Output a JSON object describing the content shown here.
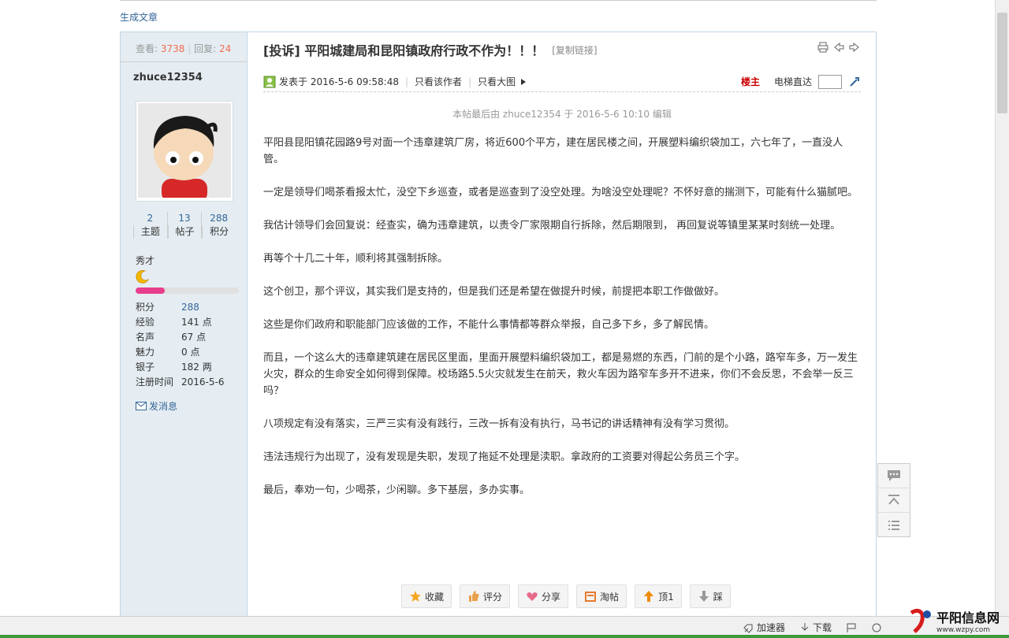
{
  "top_link": "生成文章",
  "stats": {
    "views_label": "查看:",
    "views": "3738",
    "replies_label": "回复:",
    "replies": "24"
  },
  "user": {
    "name": "zhuce12354",
    "counts": [
      {
        "value": "2",
        "label": "主题"
      },
      {
        "value": "13",
        "label": "帖子"
      },
      {
        "value": "288",
        "label": "积分"
      }
    ],
    "rank": "秀才",
    "rank_progress": 0.28,
    "info": [
      {
        "k": "积分",
        "v": "288"
      },
      {
        "k": "经验",
        "v": "141 点"
      },
      {
        "k": "名声",
        "v": "67 点"
      },
      {
        "k": "魅力",
        "v": "0 点"
      },
      {
        "k": "银子",
        "v": "182 两"
      },
      {
        "k": "注册时间",
        "v": "2016-5-6"
      }
    ],
    "message": "发消息"
  },
  "post": {
    "title": "[投诉] 平阳城建局和昆阳镇政府行政不作为！！！",
    "copy_link": "[复制链接]",
    "posted": "发表于 2016-5-6 09:58:48",
    "only_author": "只看该作者",
    "only_big_image": "只看大图",
    "owner_badge": "楼主",
    "lift_label": "电梯直达",
    "edit_note": "本帖最后由 zhuce12354 于 2016-5-6 10:10 编辑",
    "paragraphs": [
      "平阳县昆阳镇花园路9号对面一个违章建筑厂房，将近600个平方，建在居民楼之间，开展塑料编织袋加工，六七年了，一直没人管。",
      "一定是领导们喝茶看报太忙，没空下乡巡查，或者是巡查到了没空处理。为啥没空处理呢？不怀好意的揣测下，可能有什么猫腻吧。",
      "我估计领导们会回复说：经查实，确为违章建筑，以责令厂家限期自行拆除，然后期限到， 再回复说等镇里某某时刻统一处理。",
      "再等个十几二十年，顺利将其强制拆除。",
      "这个创卫，那个评议，其实我们是支持的，但是我们还是希望在做提升时候，前提把本职工作做做好。",
      "这些是你们政府和职能部门应该做的工作，不能什么事情都等群众举报，自己多下乡，多了解民情。",
      "而且，一个这么大的违章建筑建在居民区里面，里面开展塑料编织袋加工，都是易燃的东西，门前的是个小路，路窄车多，万一发生火灾，群众的生命安全如何得到保障。校场路5.5火灾就发生在前天，救火车因为路窄车多开不进来，你们不会反思，不会举一反三吗？",
      "八项规定有没有落实，三严三实有没有践行，三改一拆有没有执行，马书记的讲话精神有没有学习贯彻。",
      "违法违规行为出现了，没有发现是失职，发现了拖延不处理是渎职。拿政府的工资要对得起公务员三个字。",
      "最后，奉劝一句，少喝茶，少闲聊。多下基层，多办实事。"
    ]
  },
  "actions": [
    {
      "label": "收藏",
      "icon": "star-icon",
      "color": "#f5a623"
    },
    {
      "label": "评分",
      "icon": "thumb-icon",
      "color": "#e8a04a"
    },
    {
      "label": "分享",
      "icon": "heart-icon",
      "color": "#e86a8a"
    },
    {
      "label": "淘帖",
      "icon": "box-icon",
      "color": "#e87a2a"
    },
    {
      "label": "顶1",
      "icon": "arrow-up-icon",
      "color": "#f08a00"
    },
    {
      "label": "踩",
      "icon": "arrow-down-icon",
      "color": "#999999"
    }
  ],
  "statusbar": {
    "accelerator": "加速器",
    "download": "下载"
  },
  "logo": {
    "name": "平阳信息网",
    "url": "www.wzpy.com"
  }
}
